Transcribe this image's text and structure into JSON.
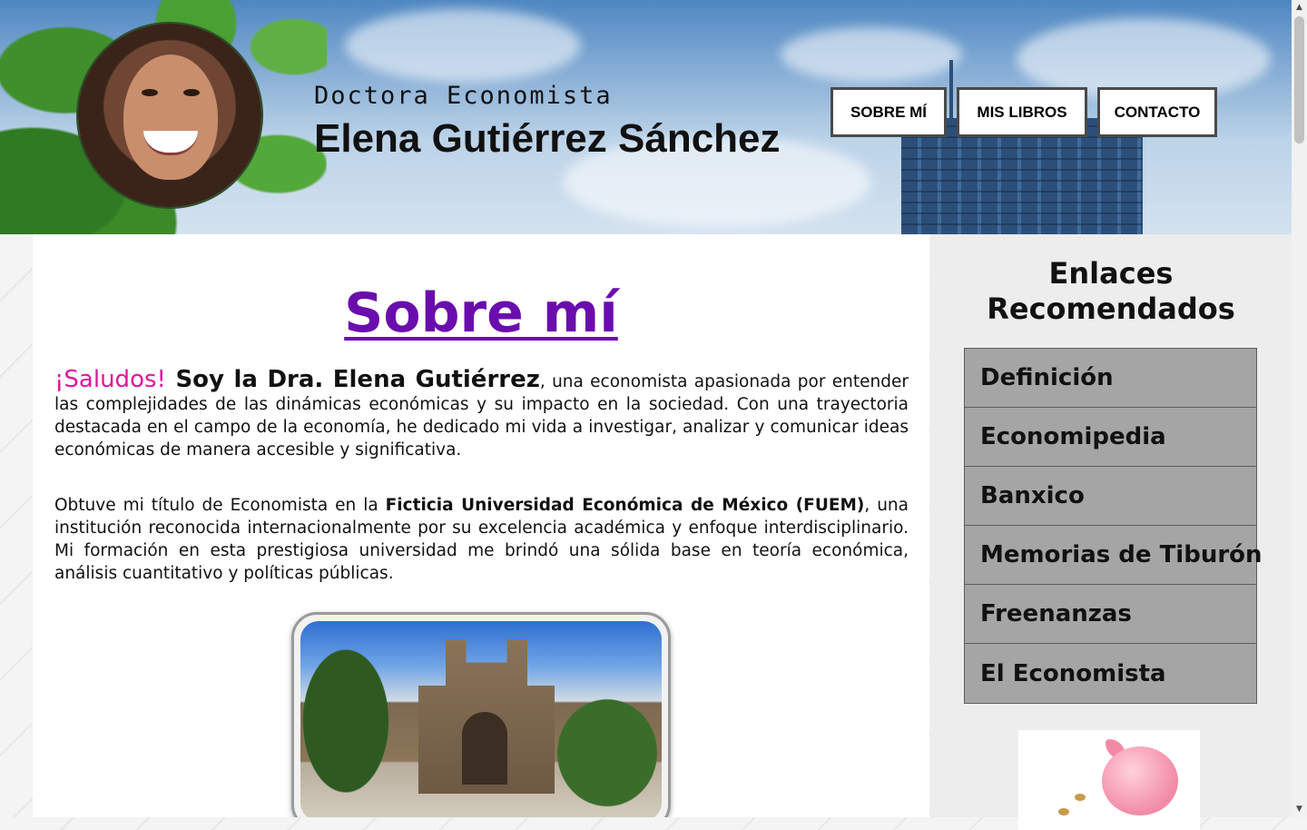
{
  "header": {
    "subtitle": "Doctora Economista",
    "name": "Elena Gutiérrez Sánchez",
    "nav": [
      {
        "label": "SOBRE MÍ"
      },
      {
        "label": "MIS LIBROS"
      },
      {
        "label": "CONTACTO"
      }
    ]
  },
  "main": {
    "title": "Sobre mí",
    "para1": {
      "greeting": "¡Saludos!",
      "intro": " Soy la Dra. Elena Gutiérrez",
      "text": ", una economista apasionada por entender las complejidades de las dinámicas económicas y su impacto en la sociedad. Con una trayectoria destacada en el campo de la economía, he dedicado mi vida a investigar, analizar y comunicar ideas económicas de manera accesible y significativa."
    },
    "para2": {
      "before": "Obtuve mi título de Economista en la ",
      "university": "Ficticia Universidad Económica de México (FUEM)",
      "after": ", una institución reconocida internacionalmente por su excelencia académica y enfoque interdisciplinario. Mi formación en esta prestigiosa universidad me brindó una sólida base en teoría económica, análisis cuantitativo y políticas públicas."
    }
  },
  "sidebar": {
    "title": "Enlaces Recomendados",
    "links": [
      {
        "label": "Definición"
      },
      {
        "label": "Economipedia"
      },
      {
        "label": "Banxico"
      },
      {
        "label": "Memorias de Tiburón"
      },
      {
        "label": "Freenanzas"
      },
      {
        "label": "El Economista"
      }
    ]
  }
}
